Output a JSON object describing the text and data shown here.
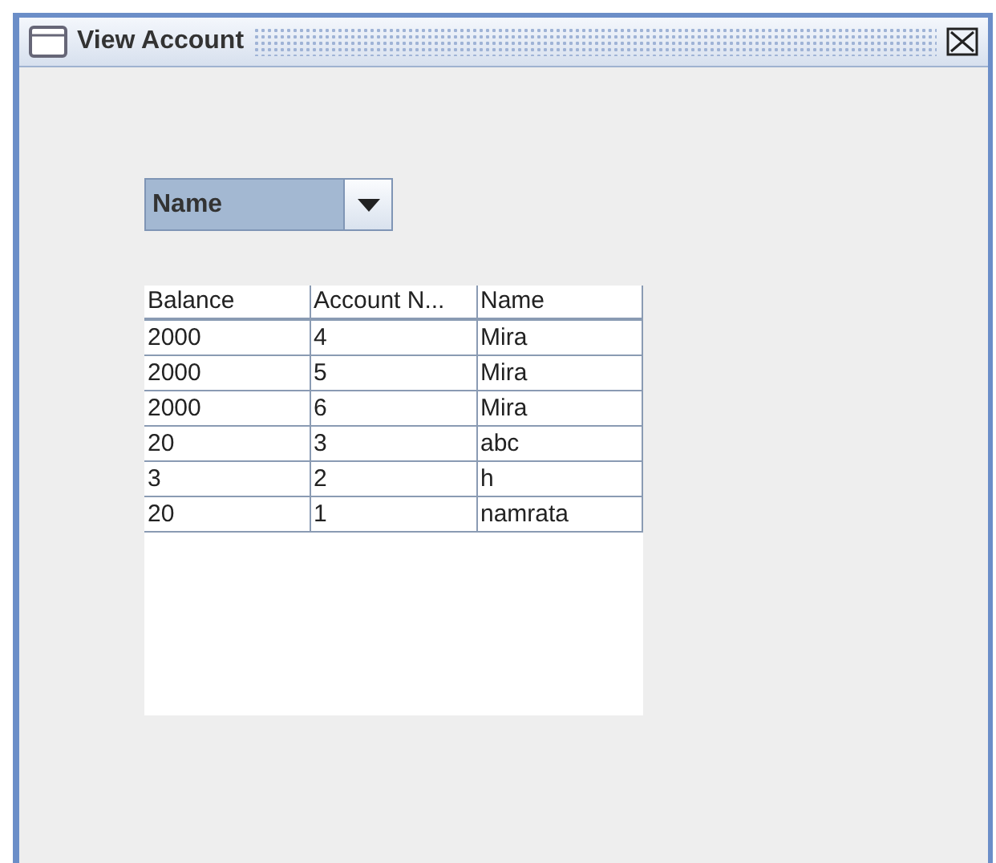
{
  "window": {
    "title": "View Account"
  },
  "sort_dropdown": {
    "value": "Name"
  },
  "table": {
    "columns": [
      "Balance",
      "Account N...",
      "Name"
    ],
    "rows": [
      [
        "2000",
        "4",
        "Mira"
      ],
      [
        "2000",
        "5",
        "Mira"
      ],
      [
        "2000",
        "6",
        "Mira"
      ],
      [
        "20",
        "3",
        "abc"
      ],
      [
        "3",
        "2",
        "h"
      ],
      [
        "20",
        "1",
        "namrata"
      ]
    ]
  }
}
